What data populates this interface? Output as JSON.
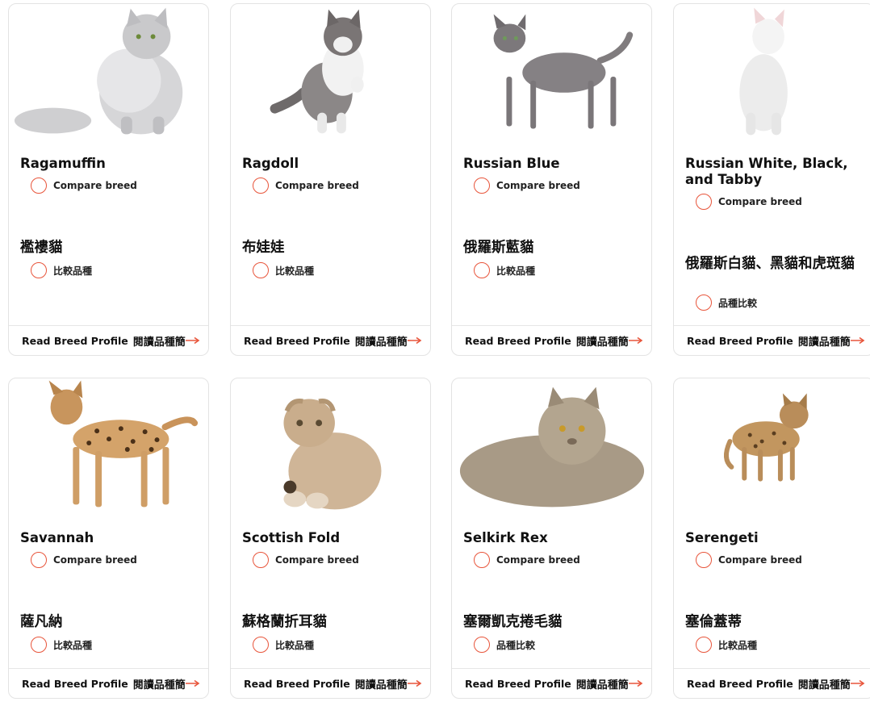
{
  "accent_color": "#e8553b",
  "cards": [
    {
      "name": "Ragamuffin",
      "compare": "Compare breed",
      "zh_name": "襤褸貓",
      "zh_compare": "比較品種",
      "read": "Read Breed Profile",
      "read_zh": "閱讀品種簡",
      "image": "long-haired silver tabby cat sitting",
      "arrow_icon": "arrow-right-icon"
    },
    {
      "name": "Ragdoll",
      "compare": "Compare breed",
      "zh_name": "布娃娃",
      "zh_compare": "比較品種",
      "read": "Read Breed Profile",
      "read_zh": "閱讀品種簡",
      "image": "grey and white ragdoll cat raising paw",
      "arrow_icon": "arrow-right-icon"
    },
    {
      "name": "Russian Blue",
      "compare": "Compare breed",
      "zh_name": "俄羅斯藍貓",
      "zh_compare": "比較品種",
      "read": "Read Breed Profile",
      "read_zh": "閱讀品種簡",
      "image": "grey russian blue cat walking",
      "arrow_icon": "arrow-right-icon"
    },
    {
      "name": "Russian White, Black, and Tabby",
      "compare": "Compare breed",
      "zh_name": "俄羅斯白貓、黑貓和虎斑貓",
      "zh_compare": "品種比較",
      "read": "Read Breed Profile",
      "read_zh": "閱讀品種簡",
      "image": "white cat sitting",
      "arrow_icon": "arrow-right-icon"
    },
    {
      "name": "Savannah",
      "compare": "Compare breed",
      "zh_name": "薩凡納",
      "zh_compare": "比較品種",
      "read": "Read Breed Profile",
      "read_zh": "閱讀品種簡",
      "image": "spotted savannah cat standing",
      "arrow_icon": "arrow-right-icon"
    },
    {
      "name": "Scottish Fold",
      "compare": "Compare breed",
      "zh_name": "蘇格蘭折耳貓",
      "zh_compare": "比較品種",
      "read": "Read Breed Profile",
      "read_zh": "閱讀品種簡",
      "image": "tabby scottish fold cat sitting",
      "arrow_icon": "arrow-right-icon"
    },
    {
      "name": "Selkirk Rex",
      "compare": "Compare breed",
      "zh_name": "塞爾凱克捲毛貓",
      "zh_compare": "品種比較",
      "read": "Read Breed Profile",
      "read_zh": "閱讀品種簡",
      "image": "curly haired cat lying down",
      "arrow_icon": "arrow-right-icon"
    },
    {
      "name": "Serengeti",
      "compare": "Compare breed",
      "zh_name": "塞倫蓋蒂",
      "zh_compare": "比較品種",
      "read": "Read Breed Profile",
      "read_zh": "閱讀品種簡",
      "image": "spotted serengeti cat standing",
      "arrow_icon": "arrow-right-icon"
    }
  ]
}
